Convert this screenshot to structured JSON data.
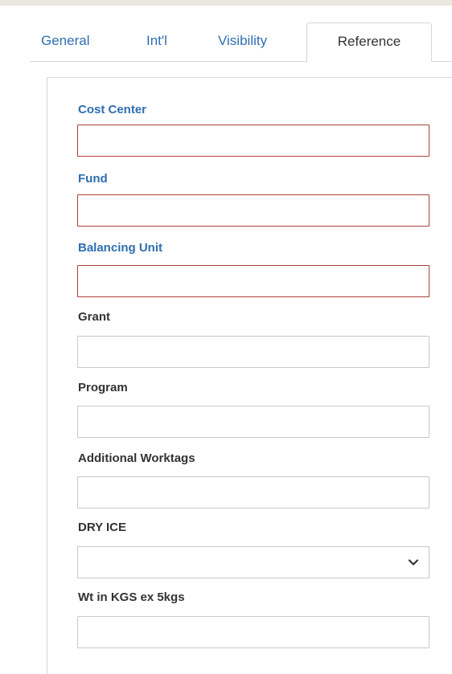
{
  "tabs": [
    {
      "label": "General",
      "active": false
    },
    {
      "label": "Int'l",
      "active": false
    },
    {
      "label": "Visibility",
      "active": false
    },
    {
      "label": "Reference",
      "active": true
    }
  ],
  "fields": {
    "cost_center": {
      "label": "Cost Center",
      "value": "",
      "required": true
    },
    "fund": {
      "label": "Fund",
      "value": "",
      "required": true
    },
    "balancing_unit": {
      "label": "Balancing Unit",
      "value": "",
      "required": true
    },
    "grant": {
      "label": "Grant",
      "value": ""
    },
    "program": {
      "label": "Program",
      "value": ""
    },
    "additional_worktags": {
      "label": "Additional Worktags",
      "value": ""
    },
    "dry_ice": {
      "label": "DRY ICE",
      "selected": ""
    },
    "wt_in_kgs": {
      "label": "Wt in KGS ex 5kgs",
      "value": ""
    }
  },
  "colors": {
    "link_blue": "#2f6eb0",
    "error_border": "#a9413b",
    "border_gray": "#c9c9c9"
  },
  "icons": {
    "dropdown": "chevron-down-icon"
  }
}
